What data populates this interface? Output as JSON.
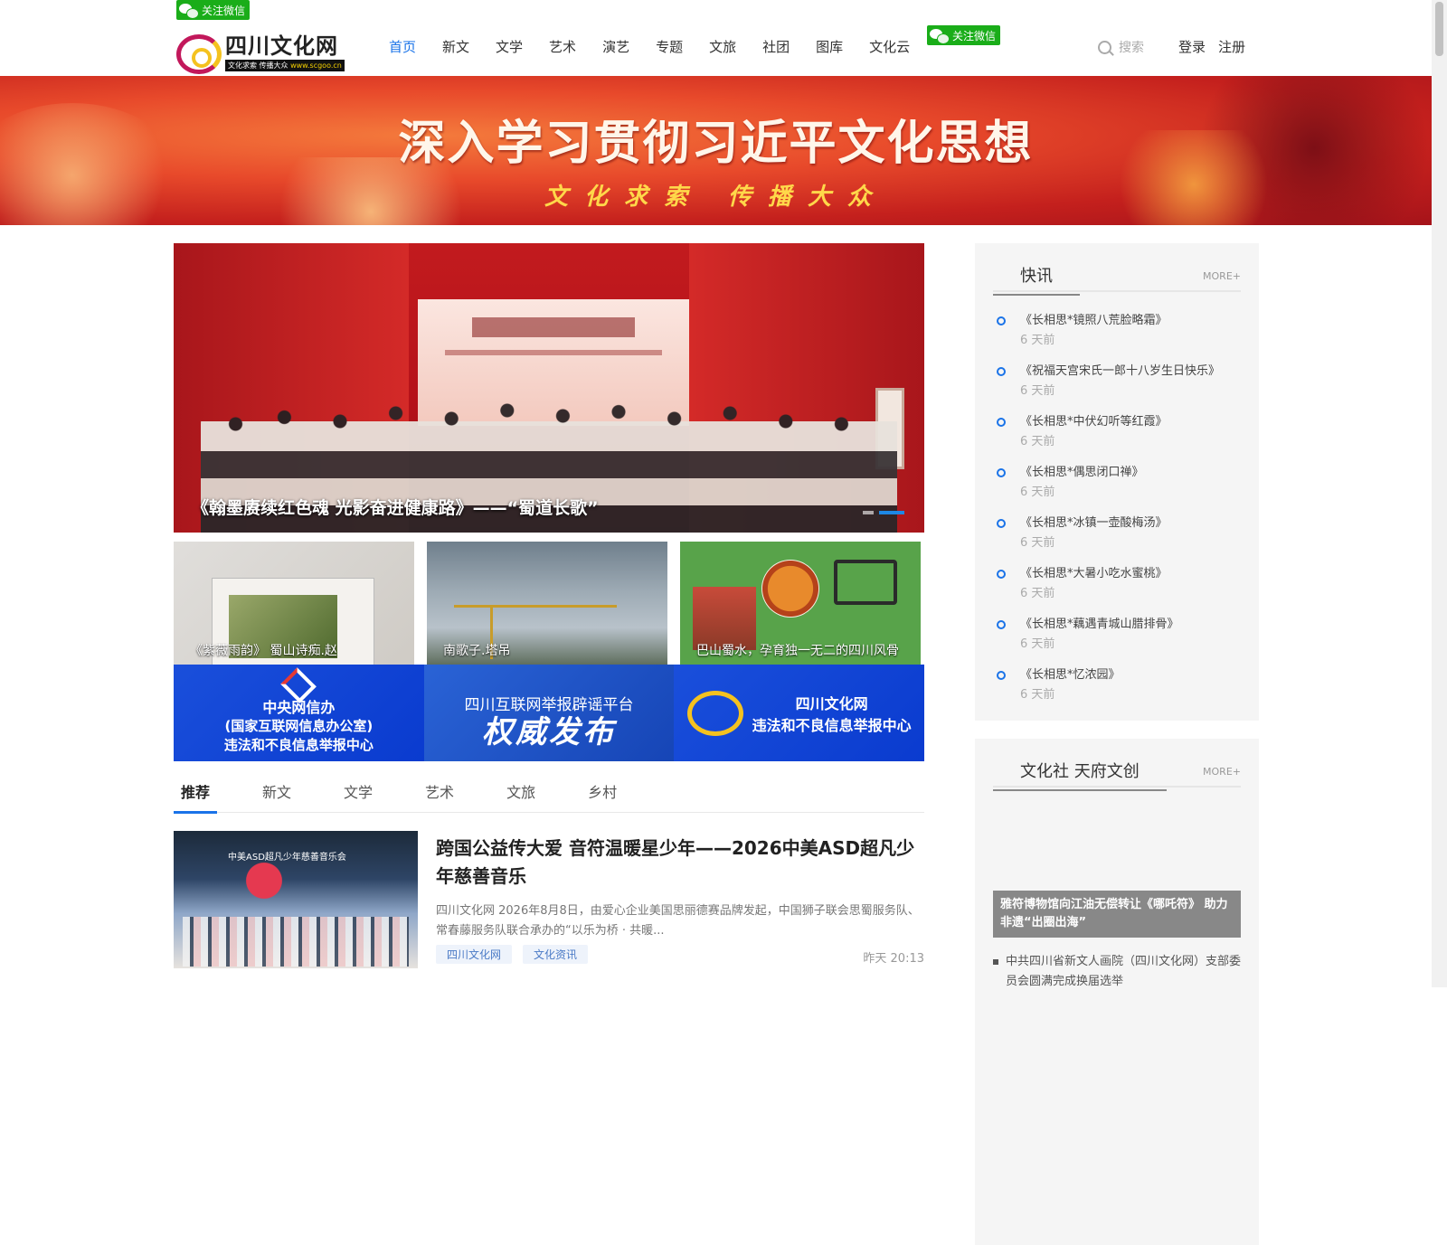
{
  "wechat": {
    "top_label": "关注微信",
    "nav_label": "关注微信"
  },
  "logo": {
    "name": "四川文化网",
    "slogan": "文化求索 传播大众",
    "url": "www.scgoo.cn"
  },
  "nav": [
    {
      "label": "首页",
      "active": true
    },
    {
      "label": "新文"
    },
    {
      "label": "文学"
    },
    {
      "label": "艺术"
    },
    {
      "label": "演艺"
    },
    {
      "label": "专题"
    },
    {
      "label": "文旅"
    },
    {
      "label": "社团"
    },
    {
      "label": "图库"
    },
    {
      "label": "文化云"
    }
  ],
  "search": {
    "placeholder": "搜索"
  },
  "auth": {
    "login": "登录",
    "register": "注册"
  },
  "banner": {
    "headline": "深入学习贯彻习近平文化思想",
    "tagline": "文化求索 传播大众"
  },
  "hero": {
    "caption": "《翰墨赓续红色魂 光影奋进健康路》——“蜀道长歌”"
  },
  "thumbs": [
    {
      "caption": "《紫薇雨韵》 蜀山诗痴.赵"
    },
    {
      "caption": "南歌子.塔吊"
    },
    {
      "caption": "巴山蜀水，孕育独一无二的四川风骨"
    }
  ],
  "notices": {
    "n1_l1": "中央网信办",
    "n1_l2": "(国家互联网信息办公室)",
    "n1_l3": "违法和不良信息举报中心",
    "n2_l1": "四川互联网举报辟谣平台",
    "n2_l2": "权威发布",
    "n3_l1": "四川文化网",
    "n3_l2": "违法和不良信息举报中心"
  },
  "tabs": [
    {
      "label": "推荐",
      "active": true
    },
    {
      "label": "新文"
    },
    {
      "label": "文学"
    },
    {
      "label": "艺术"
    },
    {
      "label": "文旅"
    },
    {
      "label": "乡村"
    }
  ],
  "article": {
    "title": "跨国公益传大爱 音符温暖星少年——2026中美ASD超凡少年慈善音乐",
    "summary": "四川文化网 2026年8月8日，由爱心企业美国思丽德赛品牌发起，中国狮子联会思蜀服务队、常春藤服务队联合承办的“以乐为桥 · 共暖...",
    "tags": [
      "四川文化网",
      "文化资讯"
    ],
    "time": "昨天 20:13",
    "image_sign": "中美ASD超凡少年慈善音乐会"
  },
  "flash": {
    "title": "快讯",
    "more": "MORE+",
    "items": [
      {
        "title": "《长相思*镜照八荒脸略霜》",
        "ago": "6 天前"
      },
      {
        "title": "《祝福天宫宋氏一郎十八岁生日快乐》",
        "ago": "6 天前"
      },
      {
        "title": "《长相思*中伏幻听等红霞》",
        "ago": "6 天前"
      },
      {
        "title": "《长相思*偶思闭口禅》",
        "ago": "6 天前"
      },
      {
        "title": "《长相思*冰镇一壶酸梅汤》",
        "ago": "6 天前"
      },
      {
        "title": "《长相思*大暑小吃水蜜桃》",
        "ago": "6 天前"
      },
      {
        "title": "《长相思*藕遇青城山腊排骨》",
        "ago": "6 天前"
      },
      {
        "title": "《长相思*忆浓园》",
        "ago": "6 天前"
      }
    ]
  },
  "culture": {
    "title": "文化社 天府文创",
    "more": "MORE+",
    "feature": "雅符博物馆向江油无偿转让《哪吒符》 助力非遗“出圈出海”",
    "news": "中共四川省新文人画院（四川文化网）支部委员会圆满完成换届选举"
  }
}
